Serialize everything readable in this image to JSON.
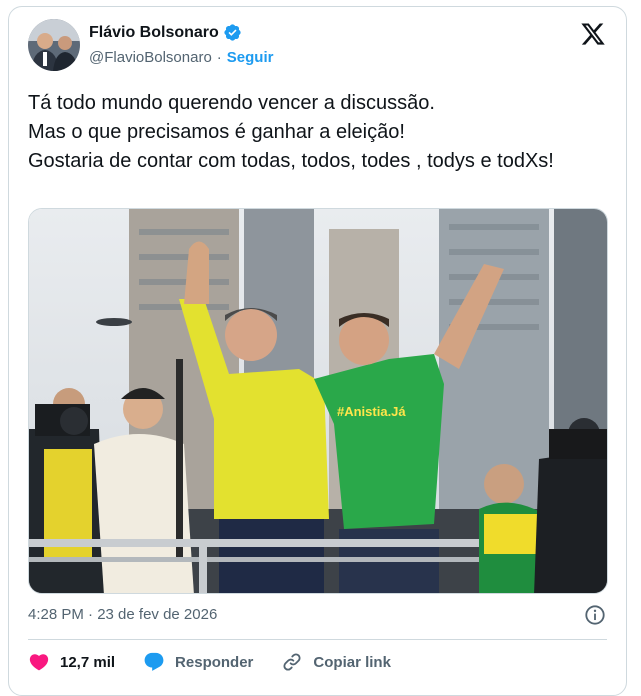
{
  "author": {
    "display_name": "Flávio Bolsonaro",
    "handle": "@FlavioBolsonaro",
    "separator": "·",
    "follow_label": "Seguir"
  },
  "tweet": {
    "text": "Tá todo mundo querendo vencer a discussão.\nMas o que precisamos é ganhar a eleição!\nGostaria de contar com todas, todos, todes , todys e todXs!",
    "timestamp": "4:28 PM · 23 de fev de 2026",
    "media_shirt_text": "#Anistia.Já"
  },
  "actions": {
    "like_count": "12,7 mil",
    "reply_label": "Responder",
    "copy_link_label": "Copiar link"
  },
  "icons": {
    "verified": "verified-badge-icon",
    "logo": "x-logo-icon",
    "info": "info-icon",
    "like": "heart-icon",
    "reply": "speech-bubble-icon",
    "link": "link-icon"
  },
  "colors": {
    "accent": "#1d9bf0",
    "like": "#f91880",
    "text": "#0f1419",
    "muted": "#536471",
    "border": "#cfd9de"
  }
}
